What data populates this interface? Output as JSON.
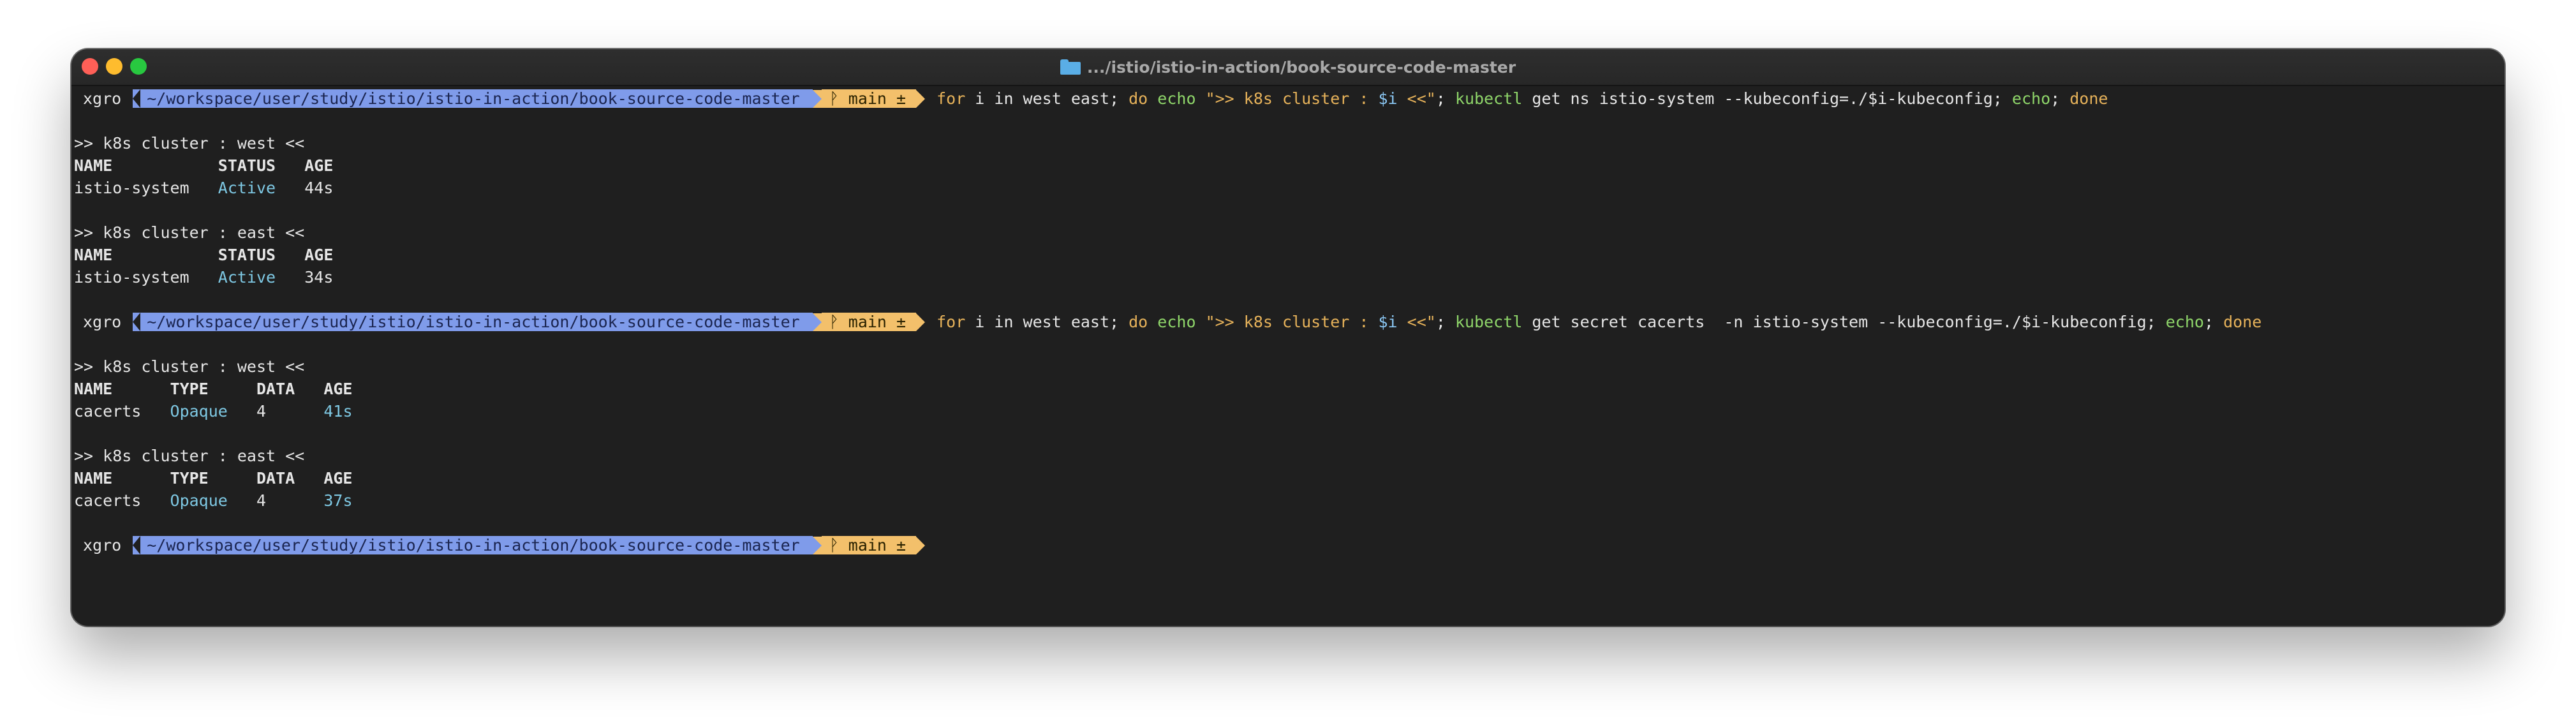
{
  "window": {
    "title": ".../istio/istio-in-action/book-source-code-master"
  },
  "prompt": {
    "user": "xgro",
    "path": "~/workspace/user/study/istio/istio-in-action/book-source-code-master",
    "branch_icon": "git-branch-icon",
    "branch": "main ±"
  },
  "commands": [
    {
      "for": "for",
      "loop": " i in west east; ",
      "do": "do",
      "echo": "echo",
      "string_open": " \">> k8s cluster : ",
      "var": "$i",
      "string_close": " <<\"",
      "sep": "; ",
      "tool": "kubectl",
      "args": " get ns istio-system --kubeconfig=./$i-kubeconfig; ",
      "echo2": "echo",
      "sep2": "; ",
      "done": "done"
    },
    {
      "for": "for",
      "loop": " i in west east; ",
      "do": "do",
      "echo": "echo",
      "string_open": " \">> k8s cluster : ",
      "var": "$i",
      "string_close": " <<\"",
      "sep": "; ",
      "tool": "kubectl",
      "args": " get secret cacerts  -n istio-system --kubeconfig=./$i-kubeconfig; ",
      "echo2": "echo",
      "sep2": "; ",
      "done": "done"
    }
  ],
  "output1": {
    "west_header": ">> k8s cluster : west <<",
    "cols": "NAME           STATUS   AGE",
    "west_row_name": "istio-system   ",
    "west_row_status": "Active",
    "west_row_age": "   44s",
    "east_header": ">> k8s cluster : east <<",
    "east_row_name": "istio-system   ",
    "east_row_status": "Active",
    "east_row_age": "   34s"
  },
  "output2": {
    "west_header": ">> k8s cluster : west <<",
    "cols": "NAME      TYPE     DATA   AGE",
    "west_row_name": "cacerts   ",
    "west_row_type": "Opaque",
    "west_row_data": "   4      ",
    "west_row_age": "41s",
    "east_header": ">> k8s cluster : east <<",
    "east_row_name": "cacerts   ",
    "east_row_type": "Opaque",
    "east_row_data": "   4      ",
    "east_row_age": "37s"
  },
  "colors": {
    "background": "#1f1f1f",
    "path_segment": "#7f9bea",
    "git_segment": "#f3c06b",
    "keyword": "#e6b25a",
    "command": "#8fd66a",
    "variable": "#8ac6f2",
    "status": "#7ec8e3"
  }
}
